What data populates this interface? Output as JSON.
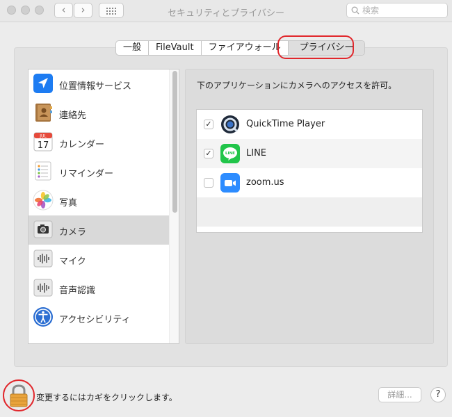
{
  "window": {
    "title": "セキュリティとプライバシー",
    "back_glyph": "‹",
    "forward_glyph": "›",
    "search": {
      "placeholder": "検索",
      "icon": "magnifier-icon"
    }
  },
  "tabs": [
    {
      "label": "一般"
    },
    {
      "label": "FileVault"
    },
    {
      "label": "ファイアウォール"
    },
    {
      "label": "プライバシー",
      "selected": true
    }
  ],
  "sidebar": {
    "items": [
      {
        "label": "位置情報サービス",
        "icon": "location-arrow-icon"
      },
      {
        "label": "連絡先",
        "icon": "contacts-book-icon"
      },
      {
        "label": "カレンダー",
        "icon": "calendar-icon",
        "icon_text": {
          "month": "JUL",
          "day": "17"
        }
      },
      {
        "label": "リマインダー",
        "icon": "reminders-icon"
      },
      {
        "label": "写真",
        "icon": "photos-icon"
      },
      {
        "label": "カメラ",
        "icon": "camera-icon",
        "selected": true
      },
      {
        "label": "マイク",
        "icon": "microphone-waveform-icon"
      },
      {
        "label": "音声認識",
        "icon": "speech-recognition-icon"
      },
      {
        "label": "アクセシビリティ",
        "icon": "accessibility-icon"
      }
    ]
  },
  "detail": {
    "description": "下のアプリケーションにカメラへのアクセスを許可。",
    "apps": [
      {
        "name": "QuickTime Player",
        "checked": true,
        "icon": "quicktime-icon"
      },
      {
        "name": "LINE",
        "checked": true,
        "icon": "line-icon",
        "icon_text": "LINE"
      },
      {
        "name": "zoom.us",
        "checked": false,
        "icon": "zoom-icon"
      }
    ]
  },
  "bottom": {
    "lock_text": "変更するにはカギをクリックします。",
    "advanced_label": "詳細...",
    "help_label": "?"
  },
  "colors": {
    "highlight_ring": "#e1272c",
    "line_green": "#21c54a",
    "zoom_blue": "#2d8cff"
  }
}
